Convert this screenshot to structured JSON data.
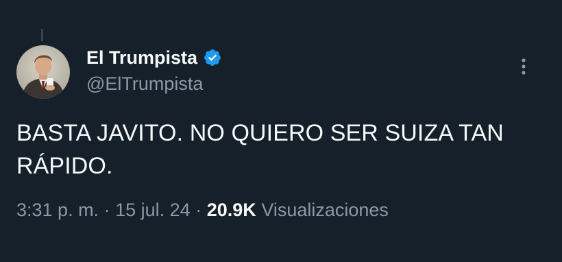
{
  "author": {
    "display_name": "El Trumpista",
    "handle": "@ElTrumpista",
    "verified": true,
    "verified_color": "#1d9bf0"
  },
  "tweet": {
    "text": "BASTA JAVITO. NO QUIERO SER SUIZA TAN RÁPIDO."
  },
  "meta": {
    "time": "3:31 p. m.",
    "separator": "·",
    "date": "15 jul. 24",
    "views_count": "20.9K",
    "views_label": "Visualizaciones"
  },
  "icons": {
    "more": "more-vertical-icon",
    "verified": "verified-badge-icon"
  },
  "colors": {
    "background": "#15202b",
    "primary_text": "#f7f9f9",
    "secondary_text": "#8b98a5"
  }
}
